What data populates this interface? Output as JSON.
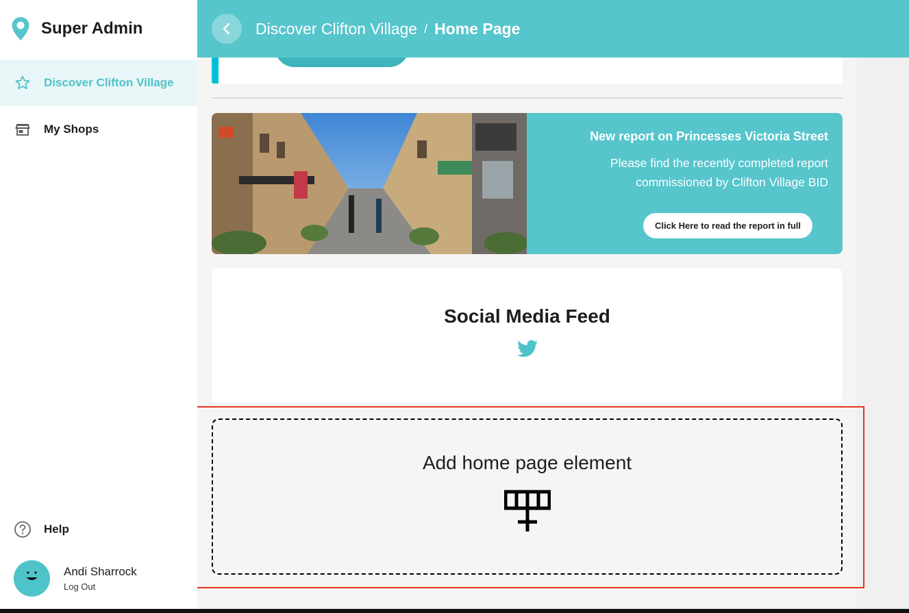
{
  "sidebar": {
    "brand_title": "Super Admin",
    "items": [
      {
        "label": "Discover Clifton Village",
        "icon": "star-icon",
        "active": true
      },
      {
        "label": "My Shops",
        "icon": "storefront-icon",
        "active": false
      }
    ],
    "help_label": "Help",
    "user": {
      "name": "Andi Sharrock",
      "logout_label": "Log Out"
    }
  },
  "header": {
    "breadcrumb_parent": "Discover Clifton Village",
    "separator": "/",
    "breadcrumb_current": "Home Page"
  },
  "banner": {
    "title": "New report on Princesses Victoria Street",
    "body": "Please find the recently completed report commissioned by Clifton Village BID",
    "button_label": "Click Here to read the report in full"
  },
  "social": {
    "title": "Social Media Feed",
    "icon": "twitter-icon"
  },
  "add_element": {
    "title": "Add home page element",
    "icon": "add-element-icon"
  },
  "colors": {
    "accent": "#56c5cc",
    "accent_dark": "#4fc3ca",
    "active_bg": "#e9f6f7",
    "highlight": "#e8321f"
  }
}
